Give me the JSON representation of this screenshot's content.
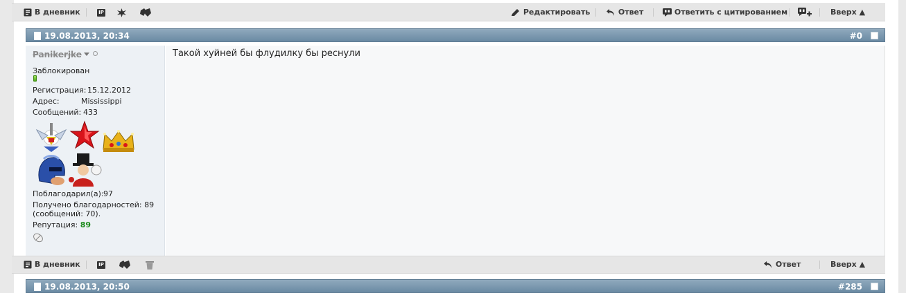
{
  "toolbar_top": {
    "diary_label": "В дневник",
    "edit_label": "Редактировать",
    "reply_label": "Ответ",
    "quote_label": "Ответить с цитированием",
    "top_label": "Вверх ▲",
    "ip_label": "IP"
  },
  "post": {
    "date": "19.08.2013, 20:34",
    "number": "#0",
    "message": "Такой хуйней бы флудилку бы реснули"
  },
  "user": {
    "name": "Panikerjke",
    "status": "Заблокирован",
    "reg_label": "Регистрация:",
    "reg_value": "15.12.2012",
    "addr_label": "Адрес:",
    "addr_value": "Mississippi",
    "posts_label": "Сообщений:",
    "posts_value": "433",
    "thanked_label": "Поблагодарил(а):",
    "thanked_value": "97",
    "received_line1": "Получено благодарностей: 89",
    "received_line2": "(сообщений: 70).",
    "rep_label": "Репутация:",
    "rep_value": "89"
  },
  "toolbar_bottom": {
    "diary_label": "В дневник",
    "reply_label": "Ответ",
    "top_label": "Вверх ▲",
    "ip_label": "IP"
  },
  "next_post": {
    "date": "19.08.2013, 20:50",
    "number": "#285"
  },
  "colors": {
    "header_bar": "#7c98ae",
    "reputation": "#1a8a1a",
    "userinfo_bg": "#edf1f5"
  }
}
